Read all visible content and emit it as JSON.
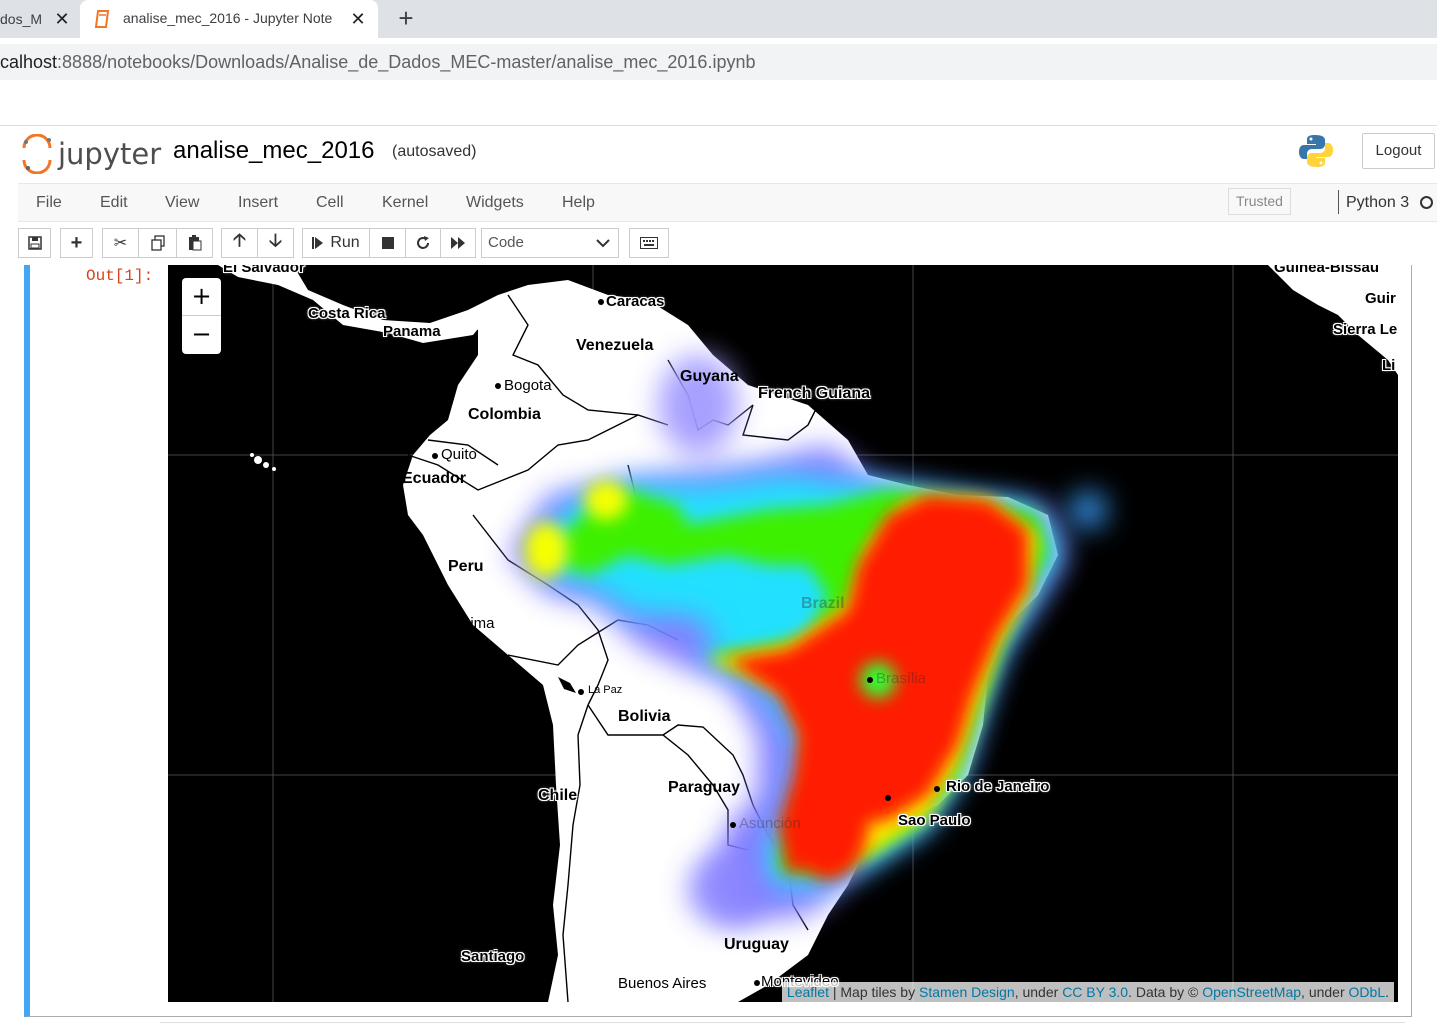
{
  "browser": {
    "prev_tab_title": "dos_M",
    "active_tab_title": "analise_mec_2016 - Jupyter Note",
    "url_host": "calhost",
    "url_rest": ":8888/notebooks/Downloads/Analise_de_Dados_MEC-master/analise_mec_2016.ipynb"
  },
  "jupyter": {
    "logo_text": "jupyter",
    "notebook_name": "analise_mec_2016",
    "autosave_status": "(autosaved)",
    "logout_label": "Logout",
    "menu": [
      "File",
      "Edit",
      "View",
      "Insert",
      "Cell",
      "Kernel",
      "Widgets",
      "Help"
    ],
    "trusted_label": "Trusted",
    "kernel_name": "Python 3",
    "run_label": "Run",
    "cell_type": "Code"
  },
  "output": {
    "prompt": "Out[1]:"
  },
  "map": {
    "zoom_in": "+",
    "zoom_out": "−",
    "labels": {
      "el_salvador": "El Salvador",
      "costa_rica": "Costa Rica",
      "panama": "Panama",
      "caracas": "Caracas",
      "venezuela": "Venezuela",
      "guyana": "Guyana",
      "french_guiana": "French Guiana",
      "bogota": "Bogota",
      "colombia": "Colombia",
      "quito": "Quito",
      "ecuador": "Ecuador",
      "peru": "Peru",
      "lima": "Lima",
      "la_paz": "La Paz",
      "bolivia": "Bolivia",
      "brazil": "Brazil",
      "brasilia": "Brasília",
      "rio": "Rio de Janeiro",
      "sao_paulo": "Sao Paulo",
      "paraguay": "Paraguay",
      "asuncion": "Asunción",
      "chile": "Chile",
      "santiago": "Santiago",
      "uruguay": "Uruguay",
      "buenos_aires": "Buenos Aires",
      "montevideo": "Montevideo",
      "guinea_bissau": "Guinea-Bissau",
      "guinea": "Guir",
      "sierra_leone": "Sierra Le",
      "liberia": "Li"
    },
    "attribution": {
      "leaflet": "Leaflet",
      "tiles_text": " | Map tiles by ",
      "stamen": "Stamen Design",
      "under1": ", under ",
      "ccby": "CC BY 3.0",
      "data_by": ". Data by © ",
      "osm": "OpenStreetMap",
      "under2": ", under ",
      "odbl": "ODbL",
      "end": "."
    },
    "heatmap_colors": [
      "#0000ff",
      "#00ffff",
      "#00ff00",
      "#ffff00",
      "#ff0000"
    ]
  }
}
